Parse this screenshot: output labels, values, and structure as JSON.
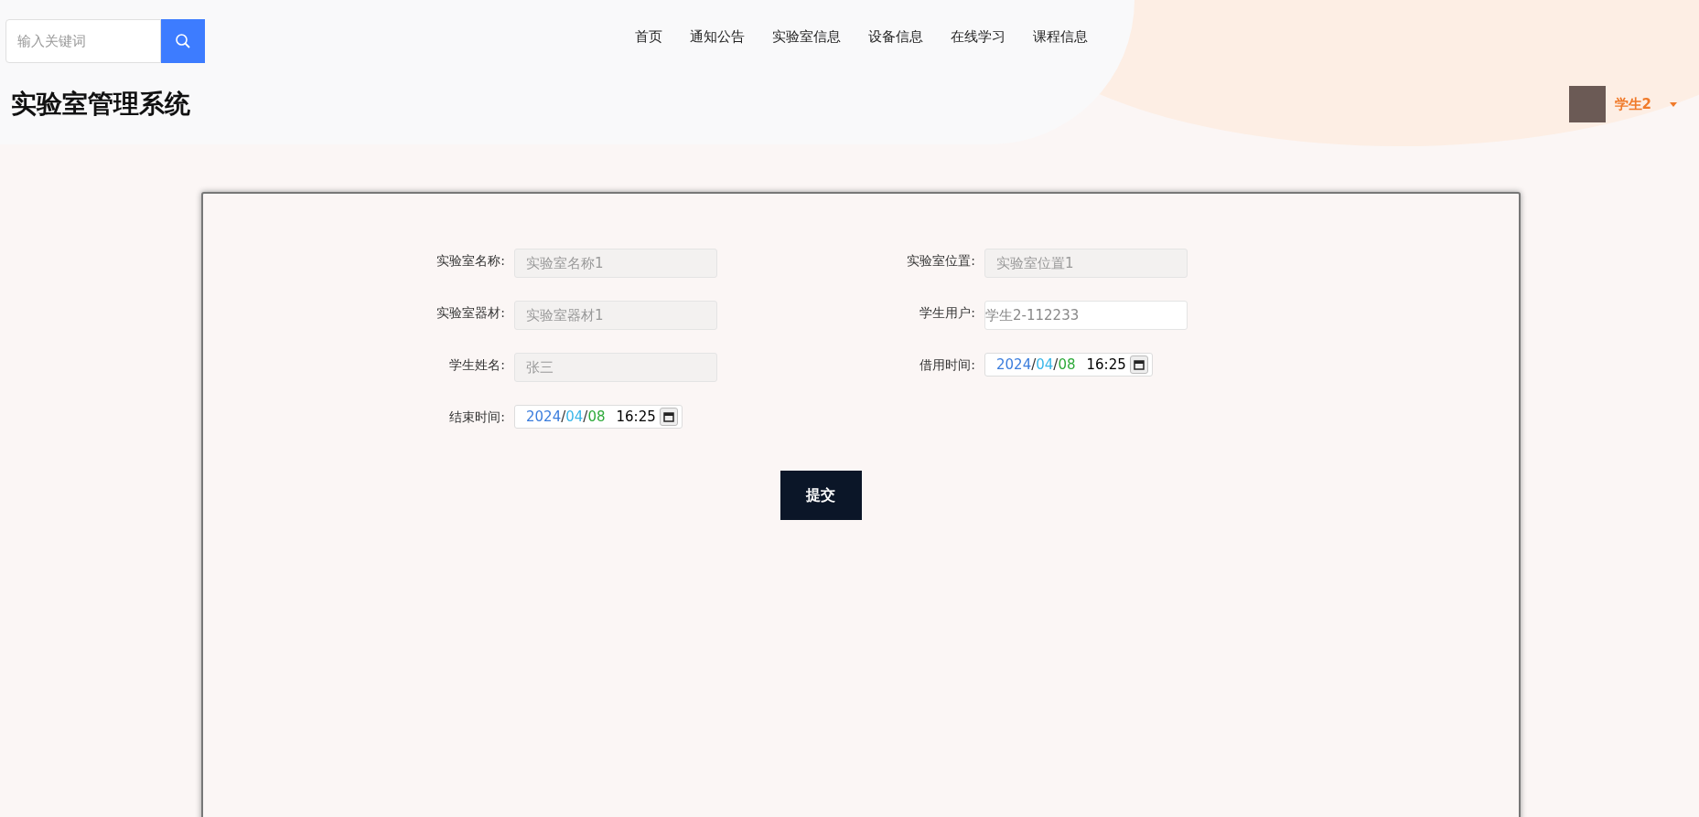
{
  "search": {
    "placeholder": "输入关键词"
  },
  "nav": [
    {
      "label": "首页"
    },
    {
      "label": "通知公告"
    },
    {
      "label": "实验室信息"
    },
    {
      "label": "设备信息"
    },
    {
      "label": "在线学习"
    },
    {
      "label": "课程信息"
    }
  ],
  "site_title": "实验室管理系统",
  "user": {
    "name": "学生2"
  },
  "form": {
    "fields": [
      {
        "kind": "text",
        "label": "实验室名称:",
        "value": "实验室名称1",
        "disabled": true
      },
      {
        "kind": "text",
        "label": "实验室位置:",
        "value": "实验室位置1",
        "disabled": true
      },
      {
        "kind": "text",
        "label": "实验室器材:",
        "value": "实验室器材1",
        "disabled": true
      },
      {
        "kind": "text",
        "label": "学生用户:",
        "value": "学生2-112233",
        "disabled": false
      },
      {
        "kind": "text",
        "label": "学生姓名:",
        "value": "张三",
        "disabled": true
      },
      {
        "kind": "datetime",
        "label": "借用时间:",
        "parts": [
          {
            "text": "2024",
            "color": "#3b7ddd"
          },
          {
            "text": "/",
            "color": "#333333"
          },
          {
            "text": "04",
            "color": "#38b6e8"
          },
          {
            "text": "/",
            "color": "#333333"
          },
          {
            "text": "08",
            "color": "#2eaa3a"
          }
        ],
        "time": "16:25"
      },
      {
        "kind": "datetime",
        "label": "结束时间:",
        "parts": [
          {
            "text": "2024",
            "color": "#3b7ddd"
          },
          {
            "text": "/",
            "color": "#333333"
          },
          {
            "text": "04",
            "color": "#38b6e8"
          },
          {
            "text": "/",
            "color": "#333333"
          },
          {
            "text": "08",
            "color": "#2eaa3a"
          }
        ],
        "time": "16:25"
      }
    ],
    "submit": "提交"
  }
}
